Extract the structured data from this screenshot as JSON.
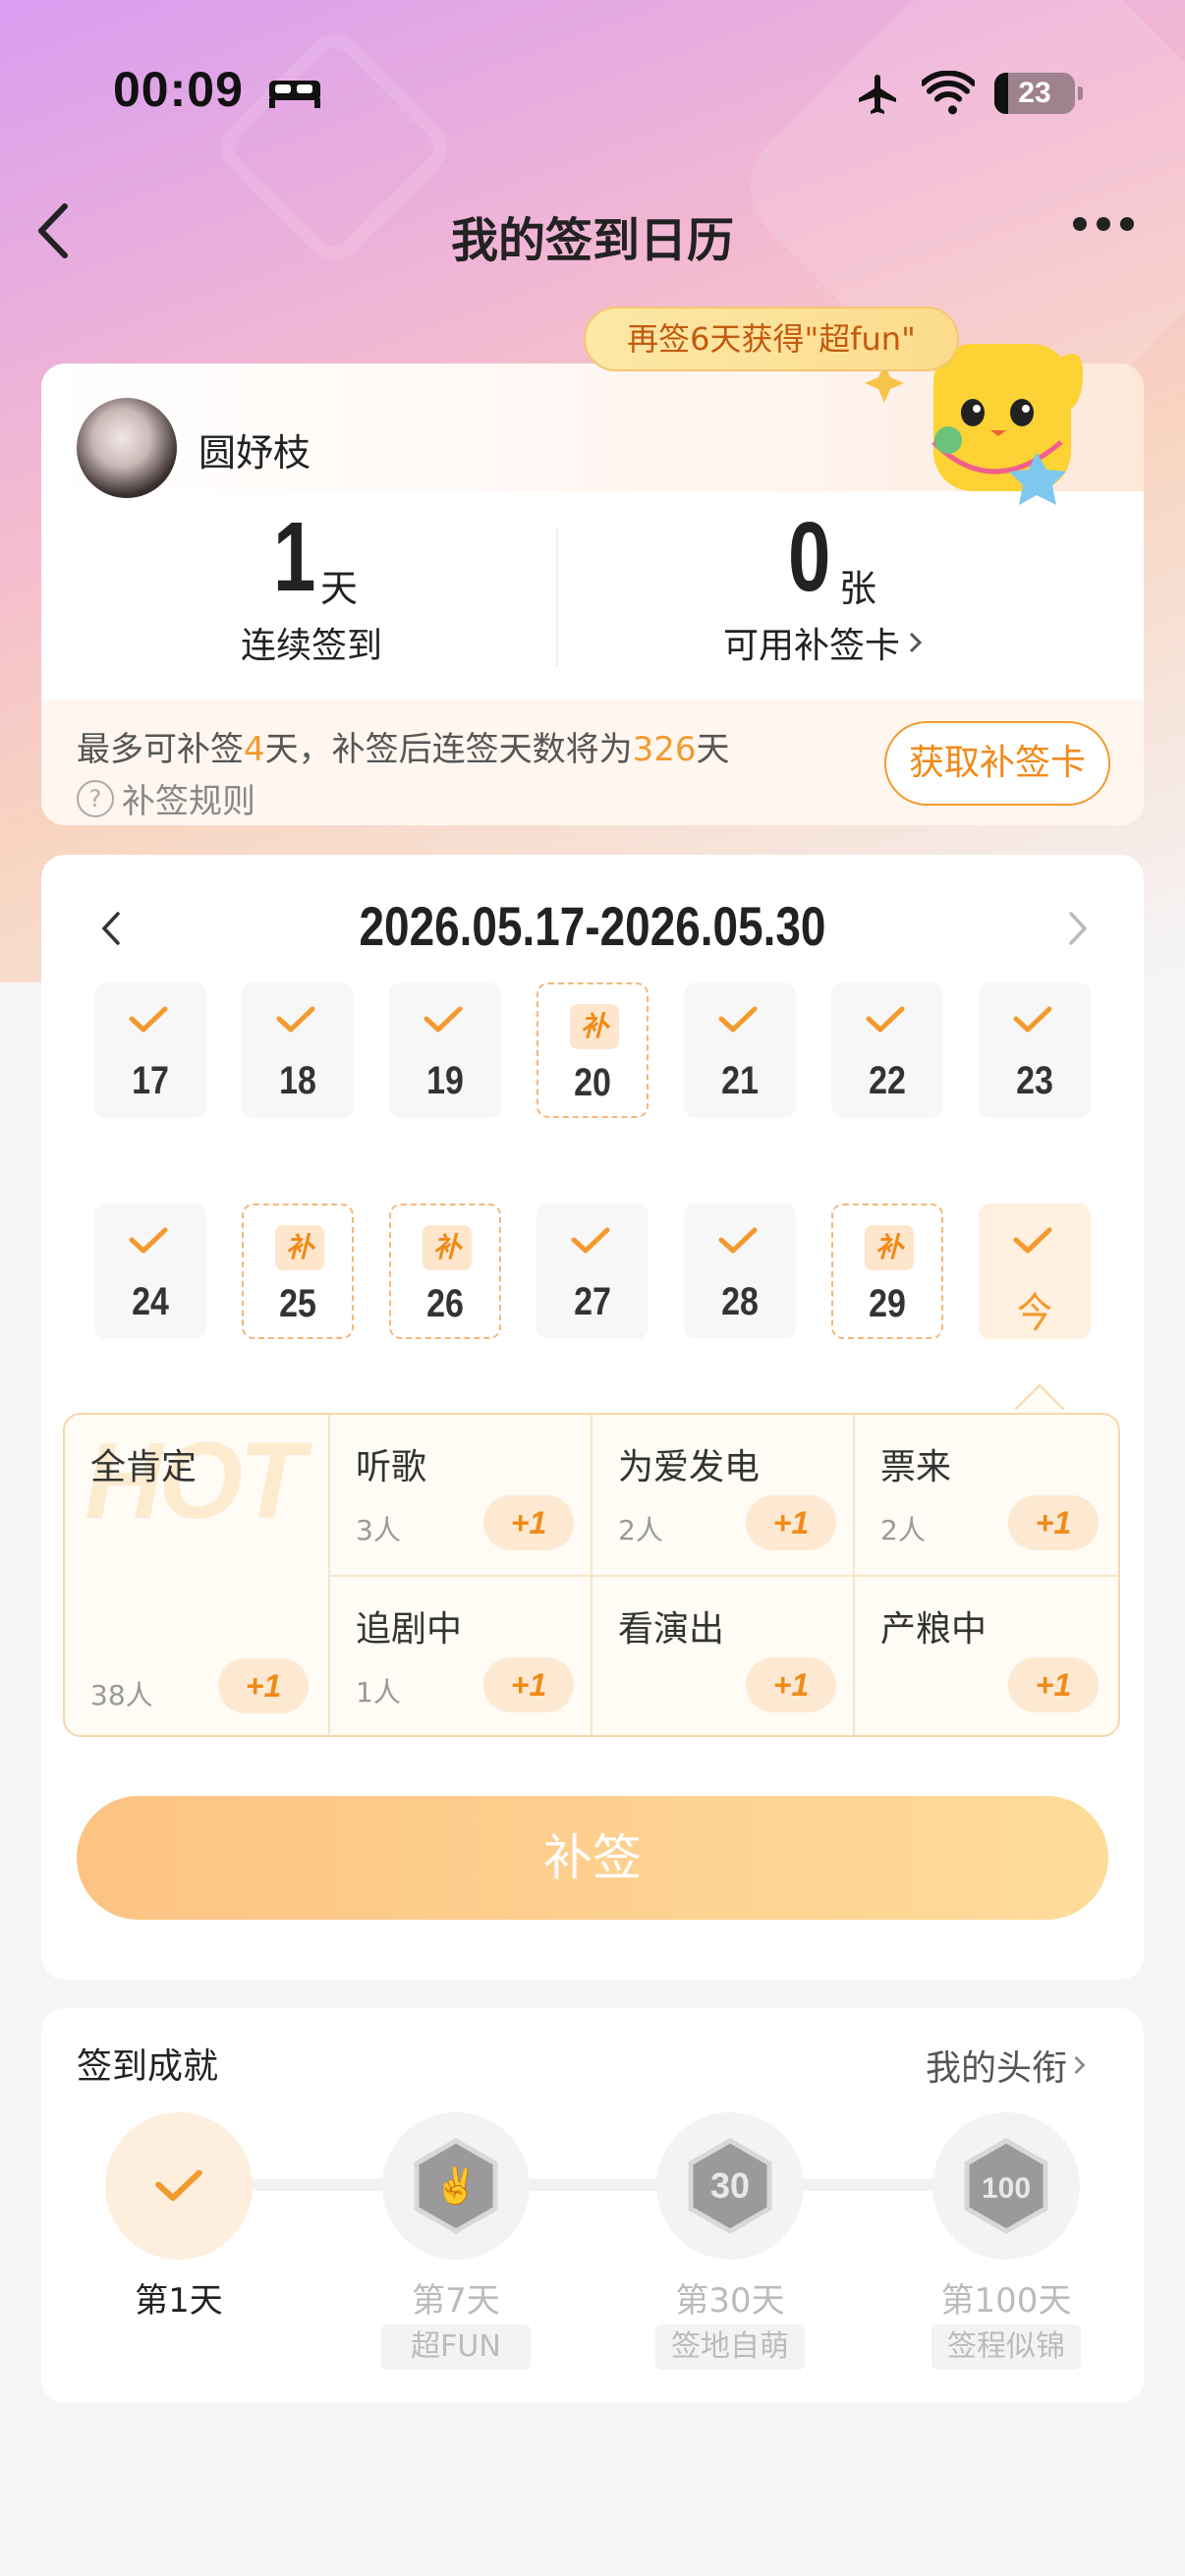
{
  "status_bar": {
    "time": "00:09",
    "battery": "23",
    "icons": [
      "bed-icon",
      "airplane-icon",
      "wifi-icon",
      "battery-icon"
    ]
  },
  "nav": {
    "title": "我的签到日历",
    "back_icon": "chevron-left-icon",
    "more_icon": "more-horizontal-icon"
  },
  "profile": {
    "username": "圆妤枝",
    "promo_badge": "再签6天获得\"超fun\"",
    "streak_value": "1",
    "streak_unit": "天",
    "streak_label": "连续签到",
    "cards_value": "0",
    "cards_unit": "张",
    "cards_label": "可用补签卡",
    "makeup_prefix": "最多可补签",
    "makeup_days": "4",
    "makeup_mid": "天，补签后连签天数将为",
    "makeup_total": "326",
    "makeup_suffix": "天",
    "rule_link": "补签规则",
    "get_card_button": "获取补签卡"
  },
  "calendar": {
    "range": "2026.05.17-2026.05.30",
    "bu_label": "补",
    "week1": [
      {
        "day": "17",
        "status": "checked"
      },
      {
        "day": "18",
        "status": "checked"
      },
      {
        "day": "19",
        "status": "checked"
      },
      {
        "day": "20",
        "status": "makeup"
      },
      {
        "day": "21",
        "status": "checked"
      },
      {
        "day": "22",
        "status": "checked"
      },
      {
        "day": "23",
        "status": "checked"
      }
    ],
    "week2": [
      {
        "day": "24",
        "status": "checked"
      },
      {
        "day": "25",
        "status": "makeup"
      },
      {
        "day": "26",
        "status": "makeup"
      },
      {
        "day": "27",
        "status": "checked"
      },
      {
        "day": "28",
        "status": "checked"
      },
      {
        "day": "29",
        "status": "makeup"
      },
      {
        "day": "今",
        "status": "today"
      }
    ]
  },
  "tags": {
    "watermark": "HOT",
    "featured": {
      "name": "全肯定",
      "count": "38人",
      "plus": "+1"
    },
    "items": [
      {
        "name": "听歌",
        "count": "3人",
        "plus": "+1"
      },
      {
        "name": "为爱发电",
        "count": "2人",
        "plus": "+1"
      },
      {
        "name": "票来",
        "count": "2人",
        "plus": "+1"
      },
      {
        "name": "追剧中",
        "count": "1人",
        "plus": "+1"
      },
      {
        "name": "看演出",
        "count": "",
        "plus": "+1"
      },
      {
        "name": "产粮中",
        "count": "",
        "plus": "+1"
      }
    ]
  },
  "makeup_button": "补签",
  "achievements": {
    "title": "签到成就",
    "link": "我的头衔",
    "items": [
      {
        "label": "第1天",
        "badge": "",
        "done": true
      },
      {
        "label": "第7天",
        "badge": "超FUN",
        "done": false
      },
      {
        "label": "第30天",
        "badge": "签地自萌",
        "done": false
      },
      {
        "label": "第100天",
        "badge": "签程似锦",
        "done": false
      }
    ]
  },
  "colors": {
    "accent": "#f39a2e",
    "button_start": "#fcc383",
    "button_end": "#ffdc9a"
  }
}
